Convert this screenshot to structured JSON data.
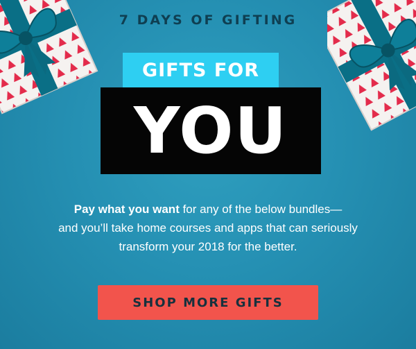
{
  "eyebrow": "7 DAYS OF GIFTING",
  "heading": {
    "line1": "GIFTS FOR",
    "line2": "YOU"
  },
  "body": {
    "lead": "Pay what you want",
    "rest1": " for any of the below bundles—",
    "line2": "and you’ll take home courses and apps that can seriously",
    "line3": "transform your 2018 for the better."
  },
  "cta": {
    "label": "SHOP MORE GIFTS"
  },
  "decorations": {
    "left": "gift-box-icon",
    "right": "gift-box-icon"
  },
  "colors": {
    "background": "#2590b3",
    "eyebrow_text": "#0f3f52",
    "tag_small_bg": "#2ecff2",
    "tag_big_bg": "#050505",
    "cta_bg": "#f2544c",
    "cta_text": "#17313d",
    "ribbon": "#0a6f86",
    "wrap_paper": "#f5f2f0",
    "wrap_print": "#e32b4b"
  }
}
